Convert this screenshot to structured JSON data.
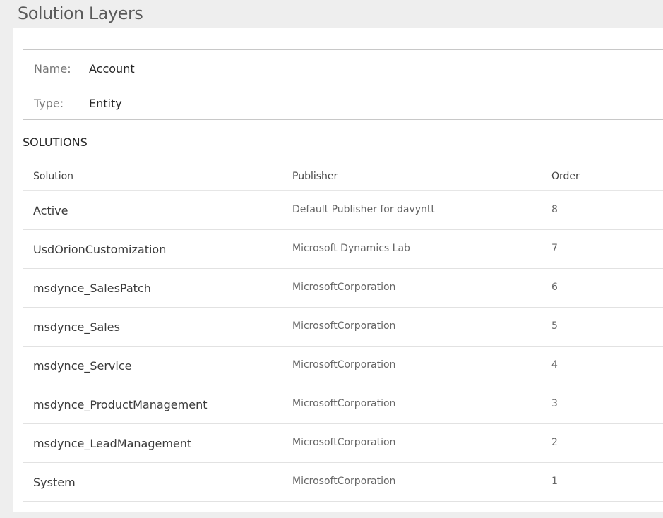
{
  "page": {
    "title": "Solution Layers"
  },
  "info": {
    "name_label": "Name:",
    "name_value": "Account",
    "type_label": "Type:",
    "type_value": "Entity"
  },
  "solutions": {
    "section_title": "SOLUTIONS",
    "columns": {
      "solution": "Solution",
      "publisher": "Publisher",
      "order": "Order"
    },
    "rows": [
      {
        "solution": "Active",
        "publisher": "Default Publisher for davyntt",
        "order": "8"
      },
      {
        "solution": "UsdOrionCustomization",
        "publisher": "Microsoft Dynamics Lab",
        "order": "7"
      },
      {
        "solution": "msdynce_SalesPatch",
        "publisher": "MicrosoftCorporation",
        "order": "6"
      },
      {
        "solution": "msdynce_Sales",
        "publisher": "MicrosoftCorporation",
        "order": "5"
      },
      {
        "solution": "msdynce_Service",
        "publisher": "MicrosoftCorporation",
        "order": "4"
      },
      {
        "solution": "msdynce_ProductManagement",
        "publisher": "MicrosoftCorporation",
        "order": "3"
      },
      {
        "solution": "msdynce_LeadManagement",
        "publisher": "MicrosoftCorporation",
        "order": "2"
      },
      {
        "solution": "System",
        "publisher": "MicrosoftCorporation",
        "order": "1"
      }
    ]
  }
}
